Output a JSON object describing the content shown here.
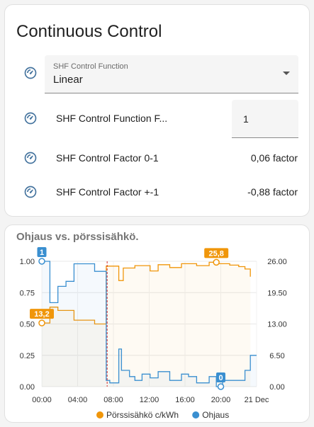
{
  "card1": {
    "title": "Continuous Control",
    "select": {
      "label": "SHF Control Function",
      "value": "Linear"
    },
    "rows": [
      {
        "label": "SHF Control Function F...",
        "value": "1"
      },
      {
        "label": "SHF Control Factor 0-1",
        "value": "0,06 factor"
      },
      {
        "label": "SHF Control Factor +-1",
        "value": "-0,88 factor"
      }
    ]
  },
  "card2": {
    "title": "Ohjaus vs. pörssisähkö."
  },
  "colors": {
    "orange": "#f0960a",
    "blue": "#3a8fd0",
    "icon": "#44739e"
  },
  "chart_data": {
    "type": "line",
    "title": "Ohjaus vs. pörssisähkö.",
    "x_ticks": [
      "00:00",
      "04:00",
      "08:00",
      "12:00",
      "16:00",
      "20:00",
      "21 Dec"
    ],
    "y_left_ticks": [
      "0.00",
      "0.25",
      "0.50",
      "0.75",
      "1.00"
    ],
    "y_right_ticks": [
      "0.00",
      "6.50",
      "13.00",
      "19.50",
      "26.00"
    ],
    "y_left_range": [
      0,
      1
    ],
    "y_right_range": [
      0,
      26
    ],
    "x_range_hours": [
      0,
      24
    ],
    "now_hour": 7.3,
    "series": [
      {
        "name": "Pörssisähkö c/kWh",
        "axis": "right",
        "color": "#f0960a",
        "x": [
          0,
          0.9,
          0.9,
          1.8,
          1.8,
          3.6,
          3.6,
          5.9,
          5.9,
          7.2,
          7.2,
          8.6,
          8.6,
          9.1,
          9.1,
          10.4,
          10.4,
          12.1,
          12.1,
          13.0,
          13.0,
          14.3,
          14.3,
          15.6,
          15.6,
          17.3,
          17.3,
          18.7,
          18.7,
          19.5,
          19.5,
          21.0,
          21.0,
          22.0,
          22.0,
          22.7,
          22.7,
          23.3,
          23.3
        ],
        "y": [
          13.2,
          13.2,
          16.5,
          16.5,
          15.8,
          15.8,
          13.8,
          13.8,
          13.0,
          13.0,
          25.0,
          25.0,
          22.0,
          22.0,
          24.6,
          24.6,
          25.1,
          25.1,
          24.0,
          24.0,
          25.3,
          25.3,
          24.7,
          24.7,
          25.5,
          25.5,
          25.1,
          25.1,
          25.8,
          25.8,
          25.5,
          25.5,
          25.2,
          25.2,
          24.9,
          24.9,
          24.4,
          24.4,
          22.8
        ]
      },
      {
        "name": "Ohjaus",
        "axis": "left",
        "color": "#3a8fd0",
        "x": [
          0,
          0.9,
          0.9,
          1.8,
          1.8,
          2.7,
          2.7,
          3.6,
          3.6,
          5.9,
          5.9,
          7.2,
          7.2,
          7.6,
          7.6,
          8.6,
          8.6,
          8.9,
          8.9,
          9.8,
          9.8,
          10.4,
          10.4,
          11.2,
          11.2,
          12.1,
          12.1,
          13.0,
          13.0,
          14.3,
          14.3,
          15.6,
          15.6,
          16.4,
          16.4,
          17.3,
          17.3,
          18.7,
          18.7,
          19.5,
          19.5,
          20.2,
          20.2,
          22.7,
          22.7,
          23.3,
          23.3,
          24
        ],
        "y": [
          1.0,
          1.0,
          0.67,
          0.67,
          0.8,
          0.8,
          0.84,
          0.84,
          0.98,
          0.98,
          0.92,
          0.92,
          0.05,
          0.05,
          0.03,
          0.03,
          0.3,
          0.3,
          0.13,
          0.13,
          0.08,
          0.08,
          0.05,
          0.05,
          0.1,
          0.1,
          0.07,
          0.07,
          0.12,
          0.12,
          0.05,
          0.05,
          0.1,
          0.1,
          0.08,
          0.08,
          0.03,
          0.03,
          0.08,
          0.08,
          0.0,
          0.0,
          0.05,
          0.05,
          0.13,
          0.13,
          0.25,
          0.25
        ]
      }
    ],
    "markers": [
      {
        "series": "Pörssisähkö c/kWh",
        "x": 0,
        "label": "13,2"
      },
      {
        "series": "Pörssisähkö c/kWh",
        "x": 19.5,
        "label": "25,8"
      },
      {
        "series": "Ohjaus",
        "x": 0,
        "label": "1"
      },
      {
        "series": "Ohjaus",
        "x": 20.0,
        "label": "0"
      }
    ],
    "legend": [
      "Pörssisähkö c/kWh",
      "Ohjaus"
    ],
    "legend_position": "bottom"
  }
}
